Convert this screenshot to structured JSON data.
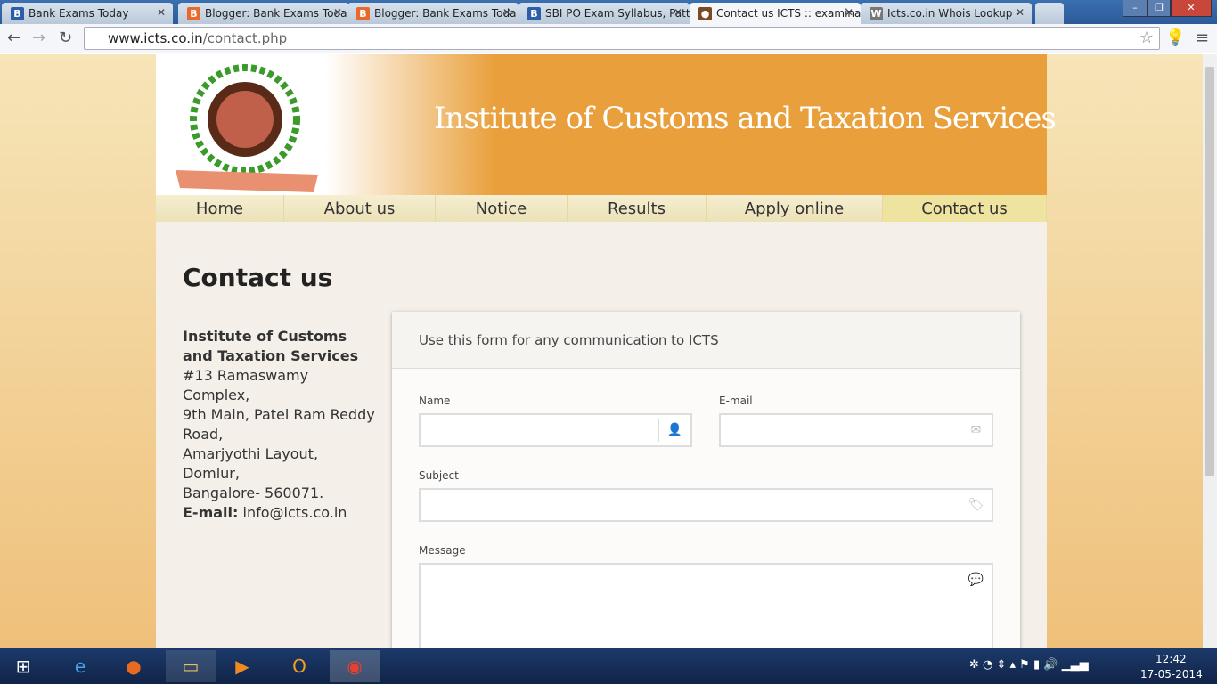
{
  "browser": {
    "tabs": [
      {
        "title": "Bank Exams Today",
        "icon": "B",
        "color": "#2a5ea8"
      },
      {
        "title": "Blogger: Bank Exams Toda",
        "icon": "B",
        "color": "#e8692a"
      },
      {
        "title": "Blogger: Bank Exams Toda",
        "icon": "B",
        "color": "#e8692a"
      },
      {
        "title": "SBI PO Exam Syllabus, Patt",
        "icon": "B",
        "color": "#2a5ea8"
      },
      {
        "title": "Contact us ICTS :: examina",
        "icon": "●",
        "color": "#7a4a20"
      },
      {
        "title": "Icts.co.in Whois Lookup -",
        "icon": "W",
        "color": "#777"
      }
    ],
    "url_host": "www.icts.co.in",
    "url_path": "/contact.php"
  },
  "site": {
    "banner_title": "Institute of Customs  and Taxation Services",
    "logo_text": "Institute of Customs & Taxation Services",
    "menu": [
      "Home",
      "About us",
      "Notice",
      "Results",
      "Apply online",
      "Contact us"
    ],
    "active_menu": "Contact us",
    "page_title": "Contact us",
    "address": {
      "name": "Institute of Customs and Taxation Services",
      "lines": [
        "#13 Ramaswamy Complex,",
        "9th Main, Patel Ram Reddy Road,",
        "Amarjyothi Layout, Domlur,",
        "Bangalore- 560071."
      ],
      "email_label": "E-mail:",
      "email": "info@icts.co.in"
    },
    "form": {
      "heading": "Use this form for any communication to ICTS",
      "name_label": "Name",
      "email_label": "E-mail",
      "subject_label": "Subject",
      "message_label": "Message"
    }
  },
  "taskbar": {
    "time": "12:42",
    "date": "17-05-2014"
  }
}
